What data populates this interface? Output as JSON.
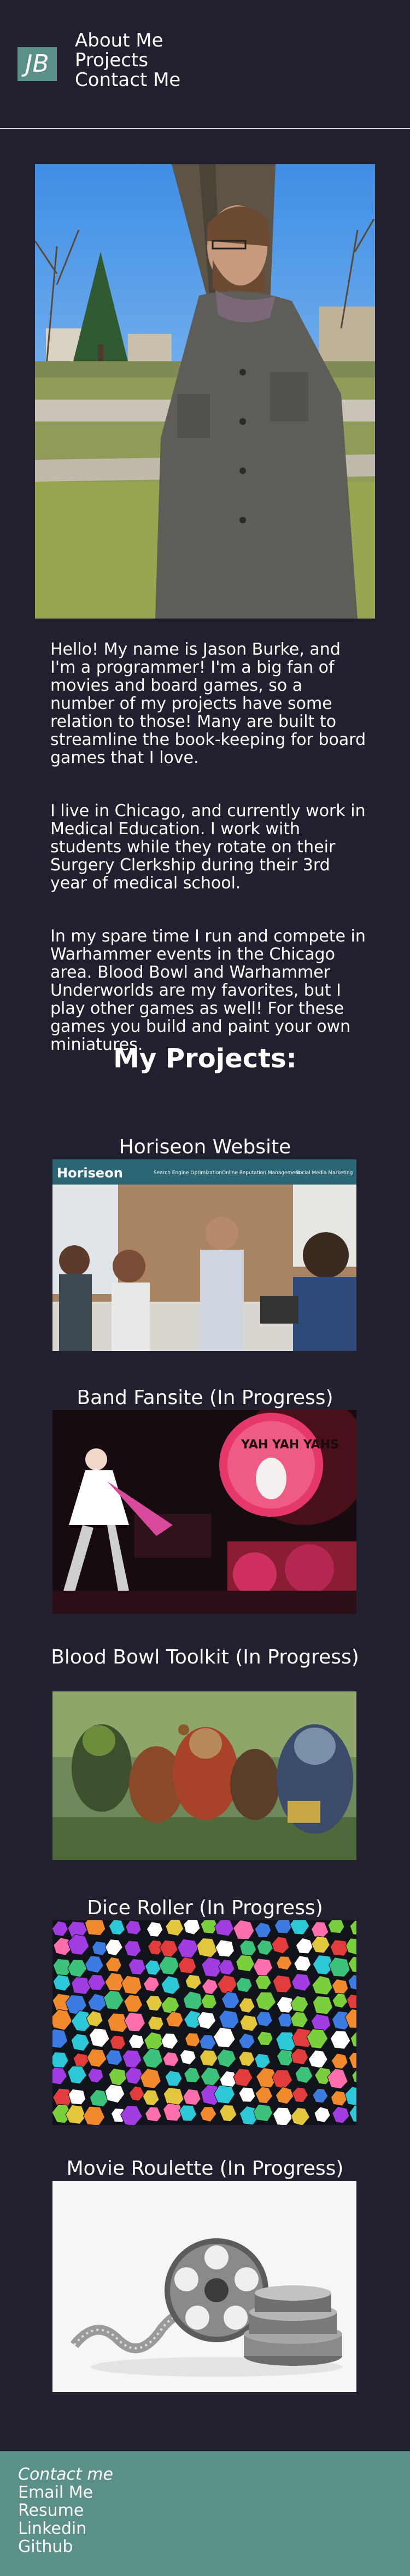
{
  "header": {
    "logo": "JB",
    "nav": [
      "About Me",
      "Projects",
      "Contact Me"
    ]
  },
  "about": {
    "paragraphs": [
      "Hello! My name is Jason Burke, and I'm a programmer! I'm a big fan of movies and board games, so a number of my projects have some relation to those! Many are built to streamline the book-keeping for board games that I love.",
      "I live in Chicago, and currently work in Medical Education. I work with students while they rotate on their Surgery Clerkship during their 3rd year of medical school.",
      "In my spare time I run and compete in Warhammer events in the Chicago area. Blood Bowl and Warhammer Underworlds are my favorites, but I play other games as well! For these games you build and paint your own miniatures."
    ]
  },
  "projects": {
    "heading": "My Projects:",
    "items": [
      {
        "title": "Horiseon Website",
        "image_text": {
          "brand": "Horiseon",
          "nav": [
            "Search Engine Optimization",
            "Online Reputation Management",
            "Social Media Marketing"
          ]
        }
      },
      {
        "title": "Band Fansite (In Progress)",
        "image_text": {
          "banner": "YAH YAH YAHS"
        }
      },
      {
        "title": "Blood Bowl Toolkit (In Progress)"
      },
      {
        "title": "Dice Roller (In Progress)"
      },
      {
        "title": "Movie Roulette (In Progress)"
      }
    ]
  },
  "footer": {
    "contact_label": "Contact me",
    "links": [
      "Email Me",
      "Resume",
      "Linkedin",
      "Github"
    ]
  }
}
